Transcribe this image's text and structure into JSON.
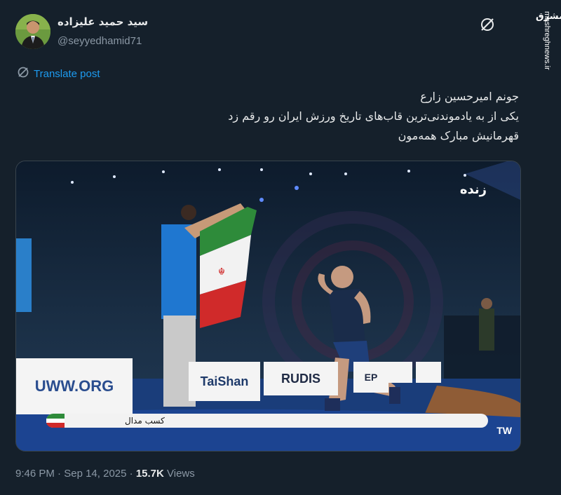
{
  "author": {
    "display_name": "سید حمید علیزاده",
    "handle": "@seyyedhamid71"
  },
  "translate_label": "Translate post",
  "post_lines": [
    "جونم امیرحسین زارع",
    "یکی از به یادموندنی‌ترین قاب‌های تاریخ ورزش ایران رو رقم زد",
    "قهرمانیش مبارک همه‌مون"
  ],
  "media": {
    "channel_logo": "زنده",
    "banners": [
      "UWW.ORG",
      "TaiShan",
      "RUDIS",
      "EP"
    ],
    "lower_third": "کسب مدال",
    "corner_tag": "TW"
  },
  "meta": {
    "time": "9:46 PM",
    "separator": "·",
    "date": "Sep 14, 2025",
    "views_count": "15.7K",
    "views_label": "Views"
  },
  "watermark": {
    "logo": "مشرق",
    "site": "mashreghnews.ir"
  },
  "colors": {
    "background": "#15202b",
    "link": "#1d9bf0",
    "secondary_text": "#8b98a5"
  }
}
